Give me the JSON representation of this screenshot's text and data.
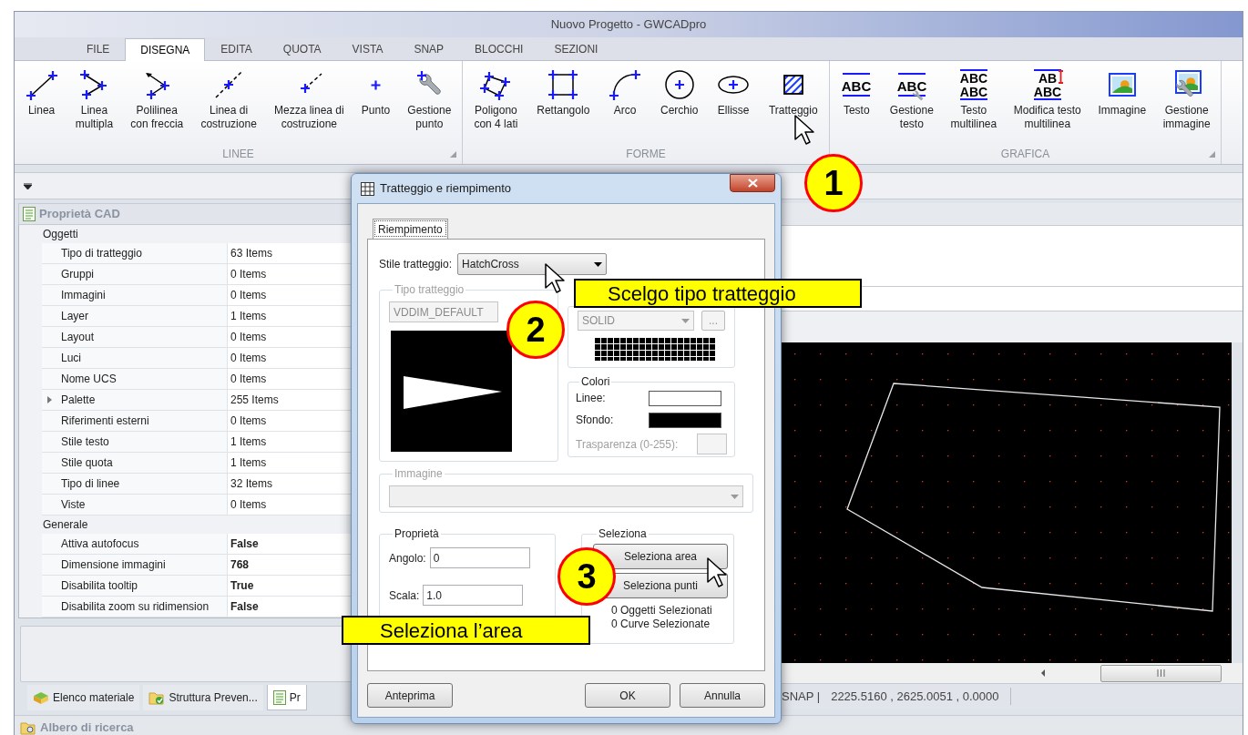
{
  "window": {
    "title": "Nuovo Progetto - GWCADpro"
  },
  "menu_tabs": [
    {
      "label": "FILE",
      "selected": false
    },
    {
      "label": "DISEGNA",
      "selected": true
    },
    {
      "label": "EDITA",
      "selected": false
    },
    {
      "label": "QUOTA",
      "selected": false
    },
    {
      "label": "VISTA",
      "selected": false
    },
    {
      "label": "SNAP",
      "selected": false
    },
    {
      "label": "BLOCCHI",
      "selected": false
    },
    {
      "label": "SEZIONI",
      "selected": false
    }
  ],
  "ribbon_groups": [
    {
      "label": "LINEE",
      "has_launcher": true,
      "tools": [
        {
          "label": "Linea",
          "kind": "line"
        },
        {
          "label": "Linea\nmultipla",
          "kind": "multiline"
        },
        {
          "label": "Polilinea\ncon freccia",
          "kind": "polyline-arrow"
        },
        {
          "label": "Linea di\ncostruzione",
          "kind": "construction-line"
        },
        {
          "label": "Mezza linea di\ncostruzione",
          "kind": "half-line"
        },
        {
          "label": "Punto",
          "kind": "point"
        },
        {
          "label": "Gestione\npunto",
          "kind": "point-settings"
        }
      ]
    },
    {
      "label": "FORME",
      "has_launcher": false,
      "tools": [
        {
          "label": "Poligono\ncon 4 lati",
          "kind": "polygon"
        },
        {
          "label": "Rettangolo",
          "kind": "rectangle"
        },
        {
          "label": "Arco",
          "kind": "arc"
        },
        {
          "label": "Cerchio",
          "kind": "circle"
        },
        {
          "label": "Ellisse",
          "kind": "ellipse"
        },
        {
          "label": "Tratteggio",
          "kind": "hatch"
        }
      ]
    },
    {
      "label": "GRAFICA",
      "has_launcher": true,
      "tools": [
        {
          "label": "Testo",
          "kind": "text",
          "icon_text": [
            "ABC"
          ]
        },
        {
          "label": "Gestione\ntesto",
          "kind": "text-settings",
          "icon_text": [
            "ABC"
          ]
        },
        {
          "label": "Testo\nmultilinea",
          "kind": "multiline-text",
          "icon_text": [
            "ABC",
            "ABC"
          ]
        },
        {
          "label": "Modifica testo\nmultilinea",
          "kind": "edit-text",
          "icon_text": [
            "AB",
            "ABC"
          ]
        },
        {
          "label": "Immagine",
          "kind": "image"
        },
        {
          "label": "Gestione\nimmagine",
          "kind": "image-settings"
        }
      ]
    }
  ],
  "properties_panel": {
    "title": "Proprietà CAD",
    "categories": [
      {
        "label": "Oggetti",
        "kind": "collections",
        "rows": [
          {
            "name": "Tipo di tratteggio",
            "value": "63 Items",
            "expandable": false
          },
          {
            "name": "Gruppi",
            "value": "0 Items",
            "expandable": false
          },
          {
            "name": "Immagini",
            "value": "0 Items",
            "expandable": false
          },
          {
            "name": "Layer",
            "value": "1 Items",
            "expandable": false
          },
          {
            "name": "Layout",
            "value": "0 Items",
            "expandable": false
          },
          {
            "name": "Luci",
            "value": "0 Items",
            "expandable": false
          },
          {
            "name": "Nome UCS",
            "value": "0 Items",
            "expandable": false
          },
          {
            "name": "Palette",
            "value": "255 Items",
            "expandable": true
          },
          {
            "name": "Riferimenti esterni",
            "value": "0 Items",
            "expandable": false
          },
          {
            "name": "Stile testo",
            "value": "1 Items",
            "expandable": false
          },
          {
            "name": "Stile quota",
            "value": "1 Items",
            "expandable": false
          },
          {
            "name": "Tipo di linee",
            "value": "32 Items",
            "expandable": false
          },
          {
            "name": "Viste",
            "value": "0 Items",
            "expandable": false
          }
        ]
      },
      {
        "label": "Generale",
        "kind": "settings",
        "rows": [
          {
            "name": "Attiva autofocus",
            "value": "False",
            "expandable": false
          },
          {
            "name": "Dimensione immagini",
            "value": "768",
            "expandable": false
          },
          {
            "name": "Disabilita tooltip",
            "value": "True",
            "expandable": false
          },
          {
            "name": "Disabilita zoom su ridimension",
            "value": "False",
            "expandable": false
          }
        ]
      }
    ]
  },
  "bottom_tabs": [
    {
      "label": "Elenco materiale",
      "selected": false
    },
    {
      "label": "Struttura Preven...",
      "selected": false
    },
    {
      "label": "Pr",
      "selected": true
    }
  ],
  "search_panel": {
    "title": "Albero di ricerca"
  },
  "status_bar": {
    "snap": "SNAP |",
    "coordinates": "2225.5160 , 2625.0051 , 0.0000"
  },
  "dialog": {
    "title": "Tratteggio e riempimento",
    "tabs": [
      {
        "label": "Riempimento",
        "selected": true
      }
    ],
    "hatch_style": {
      "label": "Stile tratteggio:",
      "value": "HatchCross"
    },
    "hatch_type": {
      "legend": "Tipo tratteggio",
      "disabled": true,
      "name": "VDDIM_DEFAULT",
      "line_type": "SOLID",
      "more": "..."
    },
    "colors": {
      "legend": "Colori",
      "items": [
        {
          "label": "Linee:",
          "color": "#ffffff"
        },
        {
          "label": "Sfondo:",
          "color": "#000000"
        }
      ],
      "transparency": {
        "label": "Trasparenza (0-255):",
        "disabled": true
      }
    },
    "image": {
      "legend": "Immagine",
      "disabled": true
    },
    "properties": {
      "legend": "Proprietà",
      "fields": [
        {
          "label": "Angolo:",
          "value": "0"
        },
        {
          "label": "Scala:",
          "value": "1.0"
        }
      ]
    },
    "selection": {
      "legend": "Seleziona",
      "buttons": [
        "Seleziona area",
        "Seleziona punti"
      ],
      "counts": [
        "0 Oggetti Selezionati",
        "0 Curve Selezionate"
      ]
    },
    "buttons": [
      "Anteprima",
      "OK",
      "Annulla"
    ]
  },
  "callouts": [
    {
      "number": "1"
    },
    {
      "number": "2",
      "text": "Scelgo tipo tratteggio"
    },
    {
      "number": "3",
      "text": "Seleziona l’area"
    }
  ]
}
